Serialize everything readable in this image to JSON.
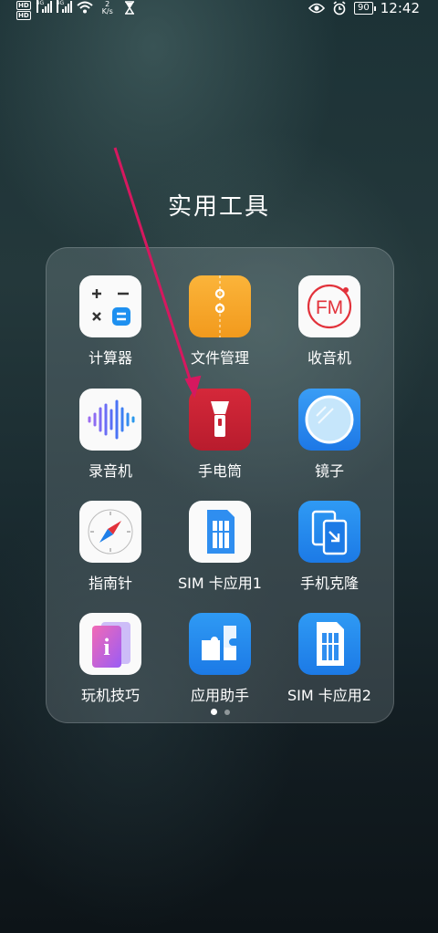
{
  "status_bar": {
    "hd1": "HD",
    "hd2": "HD",
    "net1": "4G",
    "net2": "4G",
    "speed_value": "2",
    "speed_unit": "K/s",
    "battery": "90",
    "time": "12:42"
  },
  "folder": {
    "title": "实用工具",
    "pages": 2,
    "active_page": 1,
    "apps": [
      {
        "label": "计算器",
        "icon": "calculator-icon"
      },
      {
        "label": "文件管理",
        "icon": "file-manager-icon"
      },
      {
        "label": "收音机",
        "icon": "fm-radio-icon",
        "icon_text": "FM"
      },
      {
        "label": "录音机",
        "icon": "recorder-icon"
      },
      {
        "label": "手电筒",
        "icon": "flashlight-icon"
      },
      {
        "label": "镜子",
        "icon": "mirror-icon"
      },
      {
        "label": "指南针",
        "icon": "compass-icon"
      },
      {
        "label": "SIM 卡应用1",
        "icon": "sim-card-icon"
      },
      {
        "label": "手机克隆",
        "icon": "phone-clone-icon"
      },
      {
        "label": "玩机技巧",
        "icon": "tips-icon",
        "icon_text": "i"
      },
      {
        "label": "应用助手",
        "icon": "app-assistant-icon"
      },
      {
        "label": "SIM 卡应用2",
        "icon": "sim-card-icon"
      }
    ]
  },
  "colors": {
    "annotation_arrow": "#d6185f",
    "flashlight_bg": "#c82334",
    "file_manager_bg": "#f7a928",
    "accent_blue": "#2f8ef0"
  }
}
